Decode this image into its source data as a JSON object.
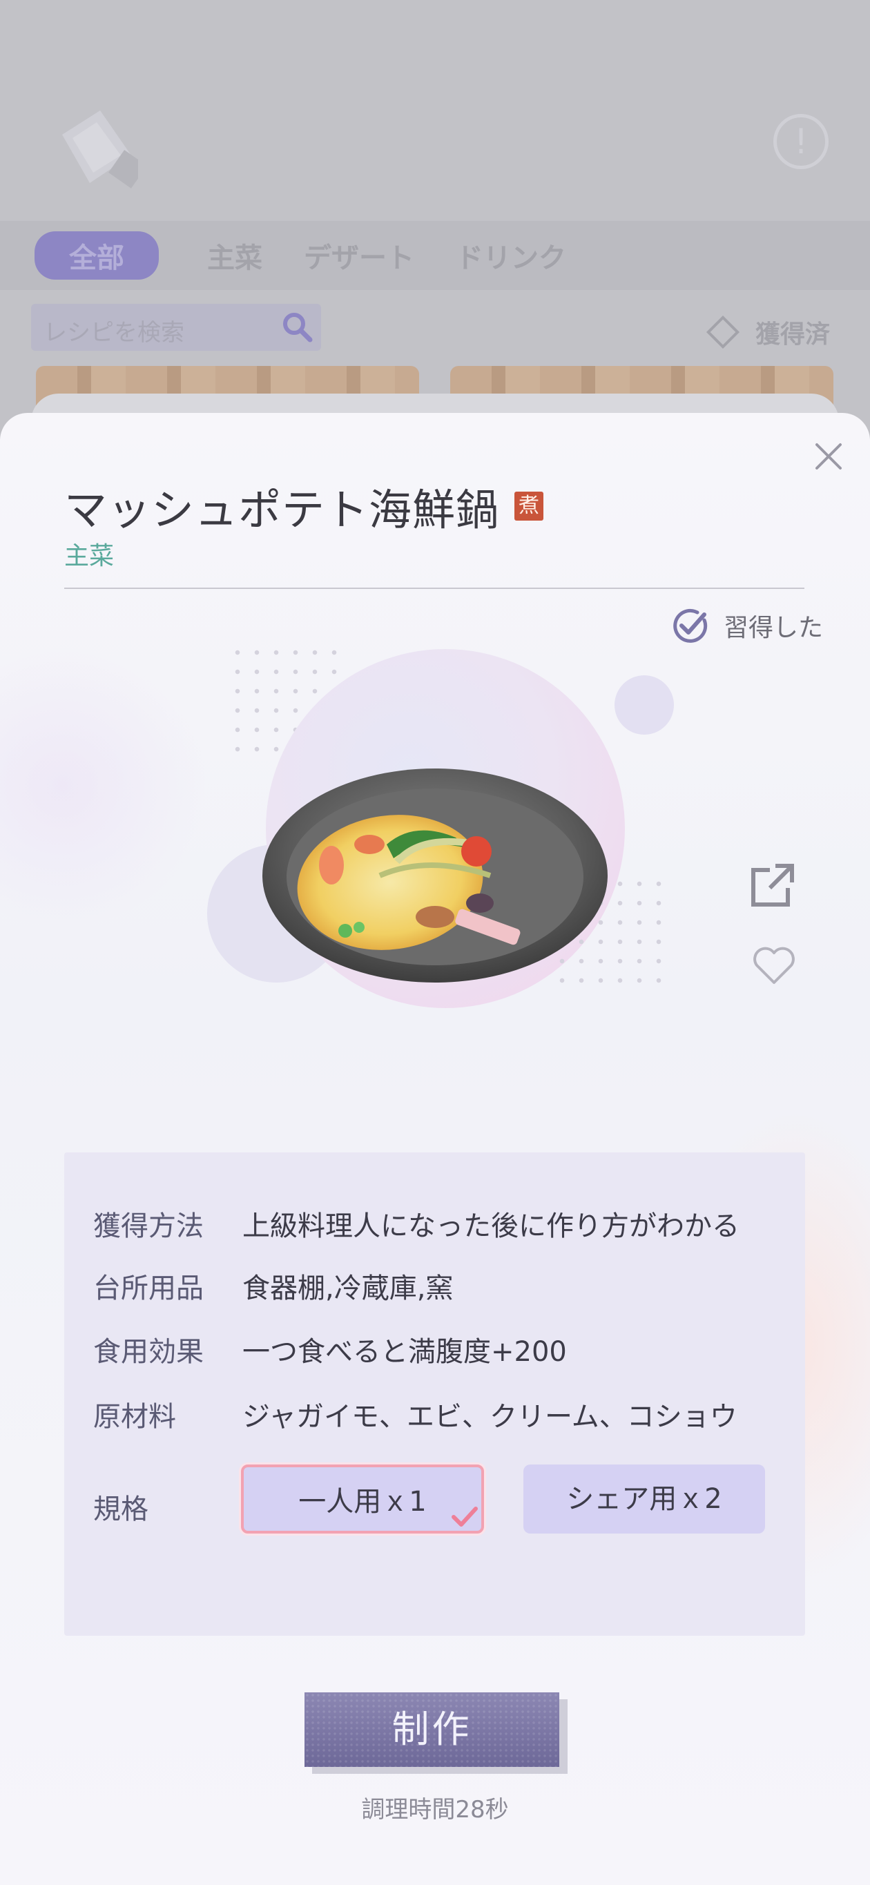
{
  "background": {
    "tabs": [
      "全部",
      "主菜",
      "デザート",
      "ドリンク"
    ],
    "active_tab": "全部",
    "search_placeholder": "レシピを検索",
    "owned_filter_label": "獲得済"
  },
  "recipe": {
    "name": "マッシュポテト海鮮鍋",
    "method_badge": "煮",
    "category": "主菜",
    "learned_label": "習得した"
  },
  "info": {
    "rows": [
      {
        "label": "獲得方法",
        "value": "上級料理人になった後に作り方がわかる"
      },
      {
        "label": "台所用品",
        "value": "食器棚,冷蔵庫,窯"
      },
      {
        "label": "食用効果",
        "value": "一つ食べると満腹度+200"
      },
      {
        "label": "原材料",
        "value": "ジャガイモ、エビ、クリーム、コショウ"
      }
    ],
    "spec_label": "規格",
    "spec_options": [
      "一人用ｘ1",
      "シェア用ｘ2"
    ],
    "spec_selected": "一人用ｘ1"
  },
  "actions": {
    "make_label": "制作",
    "cook_time": "調理時間28秒"
  },
  "colors": {
    "accent": "#7b76a8",
    "category": "#5aa99c",
    "badge": "#c9553a",
    "panel": "#e9e7f4",
    "selected_border": "#f2a2b2"
  }
}
